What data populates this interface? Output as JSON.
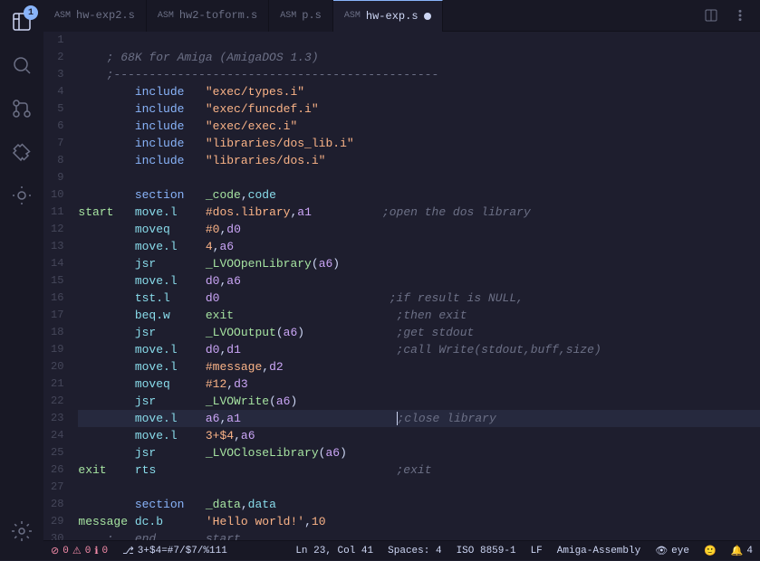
{
  "tabs": [
    {
      "id": "hw-exp2",
      "lang": "ASM",
      "label": "hw-exp2.s",
      "active": false
    },
    {
      "id": "hw2-toform",
      "lang": "ASM",
      "label": "hw2-toform.s",
      "active": false
    },
    {
      "id": "ps",
      "lang": "ASM",
      "label": "p.s",
      "active": false
    },
    {
      "id": "hw-exp",
      "lang": "ASM",
      "label": "hw-exp.s",
      "active": true,
      "modified": true
    }
  ],
  "lines": [
    {
      "num": 1,
      "content": ""
    },
    {
      "num": 2,
      "content": "    ; 68K for Amiga (AmigaDOS 1.3)"
    },
    {
      "num": 3,
      "content": "    ;----------------------------------------------"
    },
    {
      "num": 4,
      "content": "        include   \"exec/types.i\""
    },
    {
      "num": 5,
      "content": "        include   \"exec/funcdef.i\""
    },
    {
      "num": 6,
      "content": "        include   \"exec/exec.i\""
    },
    {
      "num": 7,
      "content": "        include   \"libraries/dos_lib.i\""
    },
    {
      "num": 8,
      "content": "        include   \"libraries/dos.i\""
    },
    {
      "num": 9,
      "content": ""
    },
    {
      "num": 10,
      "content": "        section   _code,code"
    },
    {
      "num": 11,
      "content": "start   move.l    #dos.library,a1          ;open the dos library"
    },
    {
      "num": 12,
      "content": "        moveq     #0,d0"
    },
    {
      "num": 13,
      "content": "        move.l    4,a6"
    },
    {
      "num": 14,
      "content": "        jsr       _LVOOpenLibrary(a6)"
    },
    {
      "num": 15,
      "content": "        move.l    d0,a6"
    },
    {
      "num": 16,
      "content": "        tst.l     d0                        ;if result is NULL,"
    },
    {
      "num": 17,
      "content": "        beq.w     exit                       ;then exit"
    },
    {
      "num": 18,
      "content": "        jsr       _LVOOutput(a6)             ;get stdout"
    },
    {
      "num": 19,
      "content": "        move.l    d0,d1                      ;call Write(stdout,buff,size)"
    },
    {
      "num": 20,
      "content": "        move.l    #message,d2"
    },
    {
      "num": 21,
      "content": "        moveq     #12,d3"
    },
    {
      "num": 22,
      "content": "        jsr       _LVOWrite(a6)"
    },
    {
      "num": 23,
      "content": "        move.l    a6,a1                      ;close library"
    },
    {
      "num": 24,
      "content": "        move.l    3+$4,a6"
    },
    {
      "num": 25,
      "content": "        jsr       _LVOCloseLibrary(a6)"
    },
    {
      "num": 26,
      "content": "exit    rts                                  ;exit"
    },
    {
      "num": 27,
      "content": ""
    },
    {
      "num": 28,
      "content": "        section   _data,data"
    },
    {
      "num": 29,
      "content": "message dc.b      'Hello world!',10"
    },
    {
      "num": 30,
      "content": "    ;   end       start"
    }
  ],
  "status": {
    "errors": "0",
    "warnings": "0",
    "infos": "0",
    "git_branch": "3+$4=#7/$7/%111",
    "ln": "Ln 23, Col 41",
    "spaces": "Spaces: 4",
    "encoding": "ISO 8859-1",
    "eol": "LF",
    "language": "Amiga-Assembly",
    "eye_icon": "eye",
    "feedback_icon": "feedback",
    "bell_icon": "bell",
    "bell_count": "4"
  },
  "activity": {
    "badge_count": "1"
  }
}
